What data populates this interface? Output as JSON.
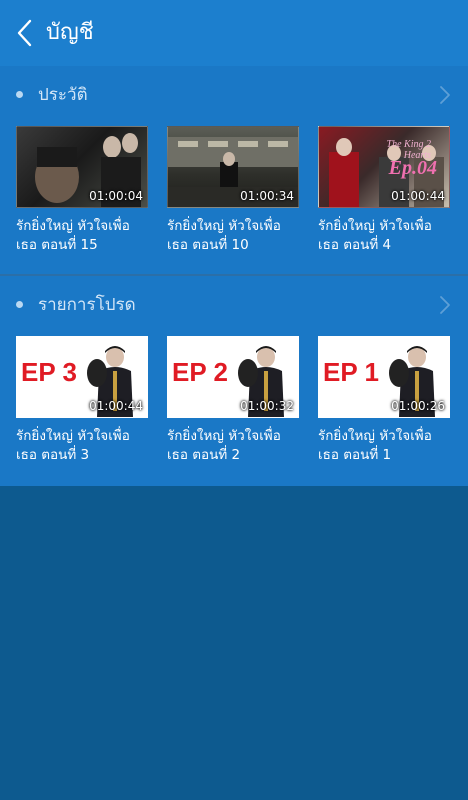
{
  "header": {
    "title": "บัญชี"
  },
  "sections": [
    {
      "title": "ประวัติ",
      "items": [
        {
          "caption": "รักยิ่งใหญ่ หัวใจเพื่อเธอ ตอนที่ 15",
          "duration": "01:00:04"
        },
        {
          "caption": "รักยิ่งใหญ่ หัวใจเพื่อเธอ ตอนที่ 10",
          "duration": "01:00:34"
        },
        {
          "caption": "รักยิ่งใหญ่ หัวใจเพื่อเธอ ตอนที่ 4",
          "duration": "01:00:44",
          "thumb_text": "Ep.04",
          "logo_text": "The King 2 Hearts"
        }
      ]
    },
    {
      "title": "รายการโปรด",
      "items": [
        {
          "caption": "รักยิ่งใหญ่ หัวใจเพื่อเธอ ตอนที่ 3",
          "duration": "01:00:44",
          "thumb_text": "EP 3"
        },
        {
          "caption": "รักยิ่งใหญ่ หัวใจเพื่อเธอ ตอนที่ 2",
          "duration": "01:00:32",
          "thumb_text": "EP 2"
        },
        {
          "caption": "รักยิ่งใหญ่ หัวใจเพื่อเธอ ตอนที่ 1",
          "duration": "01:00:26",
          "thumb_text": "EP 1"
        }
      ]
    }
  ],
  "icons": {
    "back": "chevron-left-icon",
    "more": "chevron-right-icon"
  },
  "colors": {
    "appbar": "#1c7fce",
    "content": "#1a78c6",
    "background": "#0d5a8f",
    "ep_text": "#e01b24"
  }
}
